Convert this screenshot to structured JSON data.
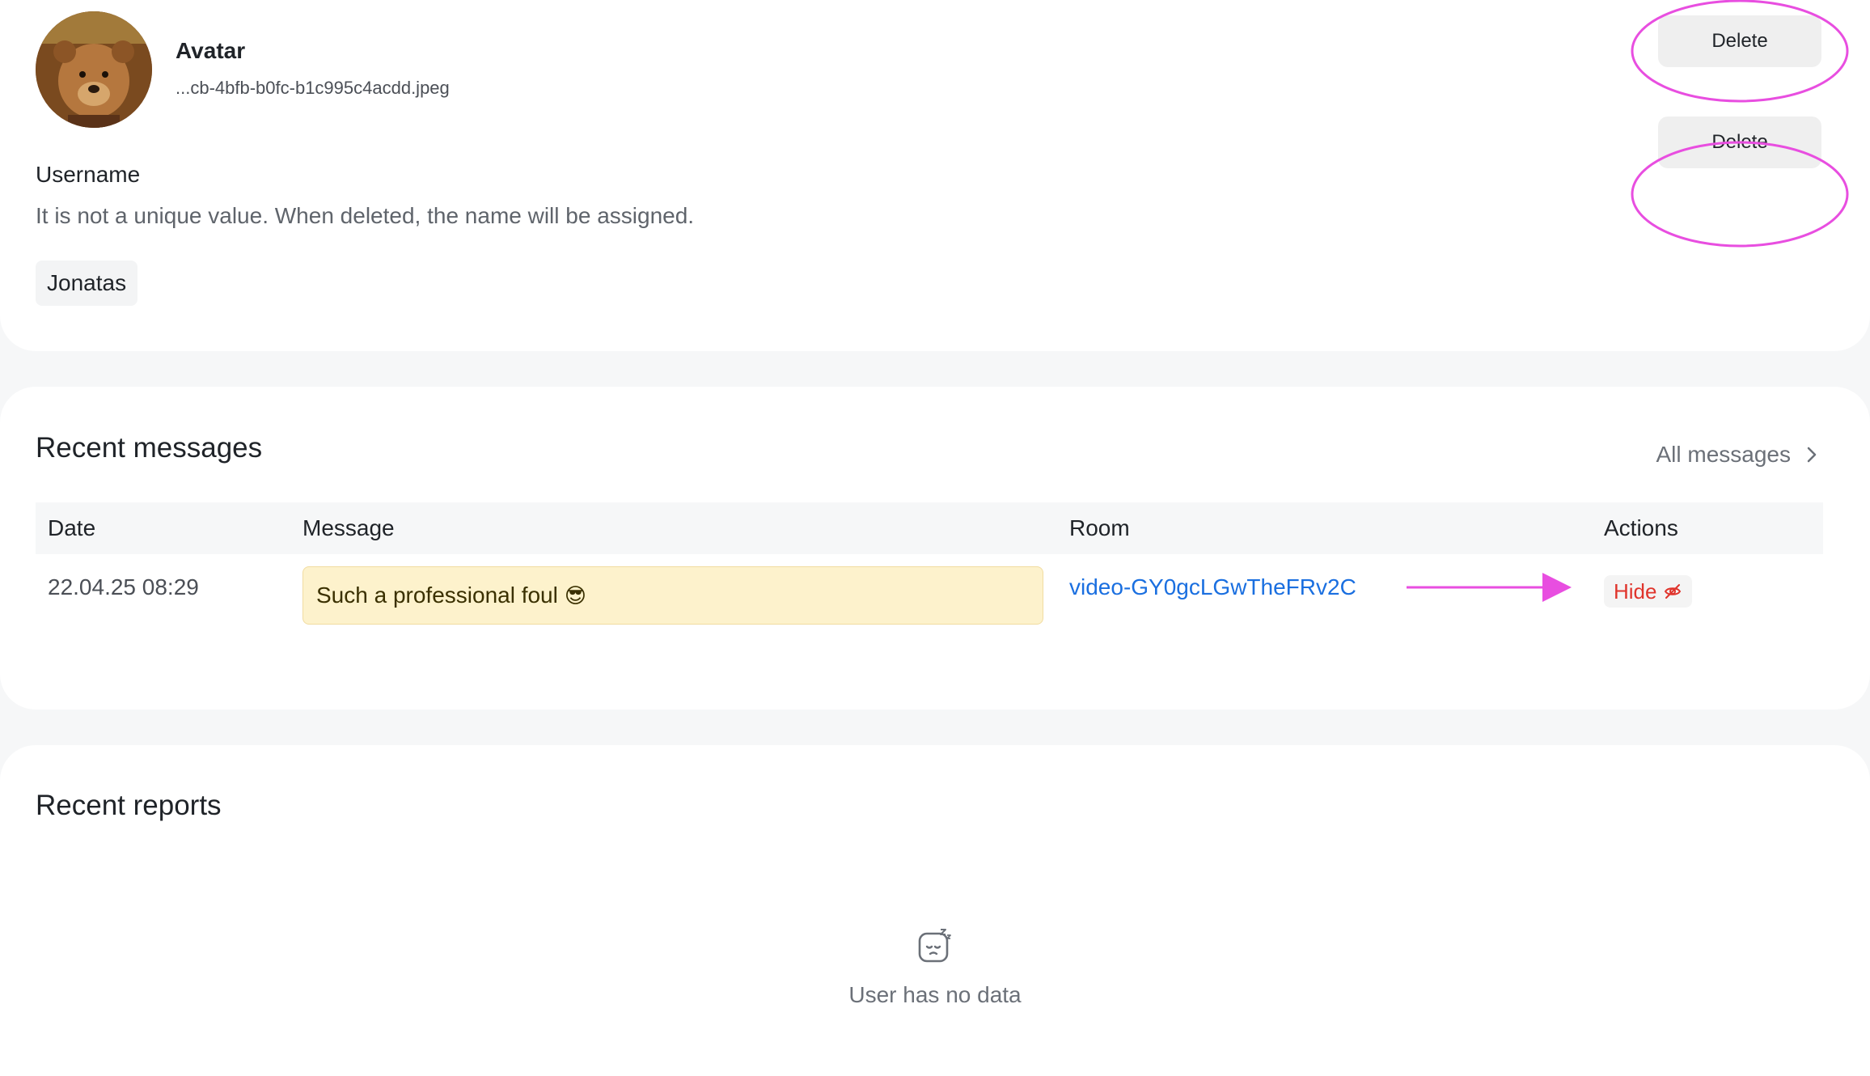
{
  "profile": {
    "avatar": {
      "title": "Avatar",
      "filename": "...cb-4bfb-b0fc-b1c995c4acdd.jpeg",
      "delete_label": "Delete"
    },
    "username": {
      "title": "Username",
      "description": "It is not a unique value. When deleted, the name will be assigned.",
      "value": "Jonatas",
      "delete_label": "Delete"
    }
  },
  "messages": {
    "title": "Recent messages",
    "all_link": "All messages",
    "columns": [
      "Date",
      "Message",
      "Room",
      "Actions"
    ],
    "rows": [
      {
        "date": "22.04.25 08:29",
        "message": "Such a professional foul",
        "emoji": "😎",
        "room": "video-GY0gcLGwTheFRv2C",
        "action": "Hide"
      }
    ]
  },
  "reports": {
    "title": "Recent reports",
    "empty_text": "User has no data"
  },
  "colors": {
    "link": "#1a6fe0",
    "danger": "#e0342c",
    "highlight": "#fdf2cc",
    "annotation": "#e84ee0"
  }
}
